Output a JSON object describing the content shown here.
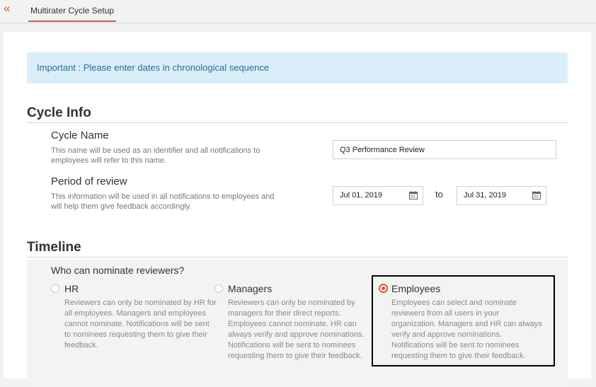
{
  "header": {
    "back_icon": "«",
    "tab_label": "Multirater Cycle Setup",
    "accent_color": "#e8572a"
  },
  "alert": {
    "text": "Important : Please enter dates in chronological sequence"
  },
  "cycle_info": {
    "title": "Cycle Info",
    "cycle_name": {
      "label": "Cycle Name",
      "description": "This name will be used as an identifier and all notifications to employees will refer to this name.",
      "value": "Q3 Performance Review"
    },
    "period": {
      "label": "Period of review",
      "description": "This information will be used in all notifications to employees and will help them give feedback accordingly.",
      "start": "Jul 01, 2019",
      "to_label": "to",
      "end": "Jul 31, 2019"
    }
  },
  "timeline": {
    "title": "Timeline",
    "question": "Who can nominate reviewers?",
    "options": [
      {
        "title": "HR",
        "description": "Reviewers can only be nominated by HR for all employees. Managers and employees cannot nominate. Notifications will be sent to nominees requesting them to give their feedback.",
        "selected": false
      },
      {
        "title": "Managers",
        "description": "Reviewers can only be nominated by managers for their direct reports. Employees cannot nominate. HR can always verify and approve nominations. Notifications will be sent to nominees requesting them to give their feedback.",
        "selected": false
      },
      {
        "title": "Employees",
        "description": "Employees can select and nominate reviewers from all users in your organization. Managers and HR can always verify and approve nominations. Notifications will be sent to nominees requesting them to give their feedback.",
        "selected": true
      }
    ]
  }
}
